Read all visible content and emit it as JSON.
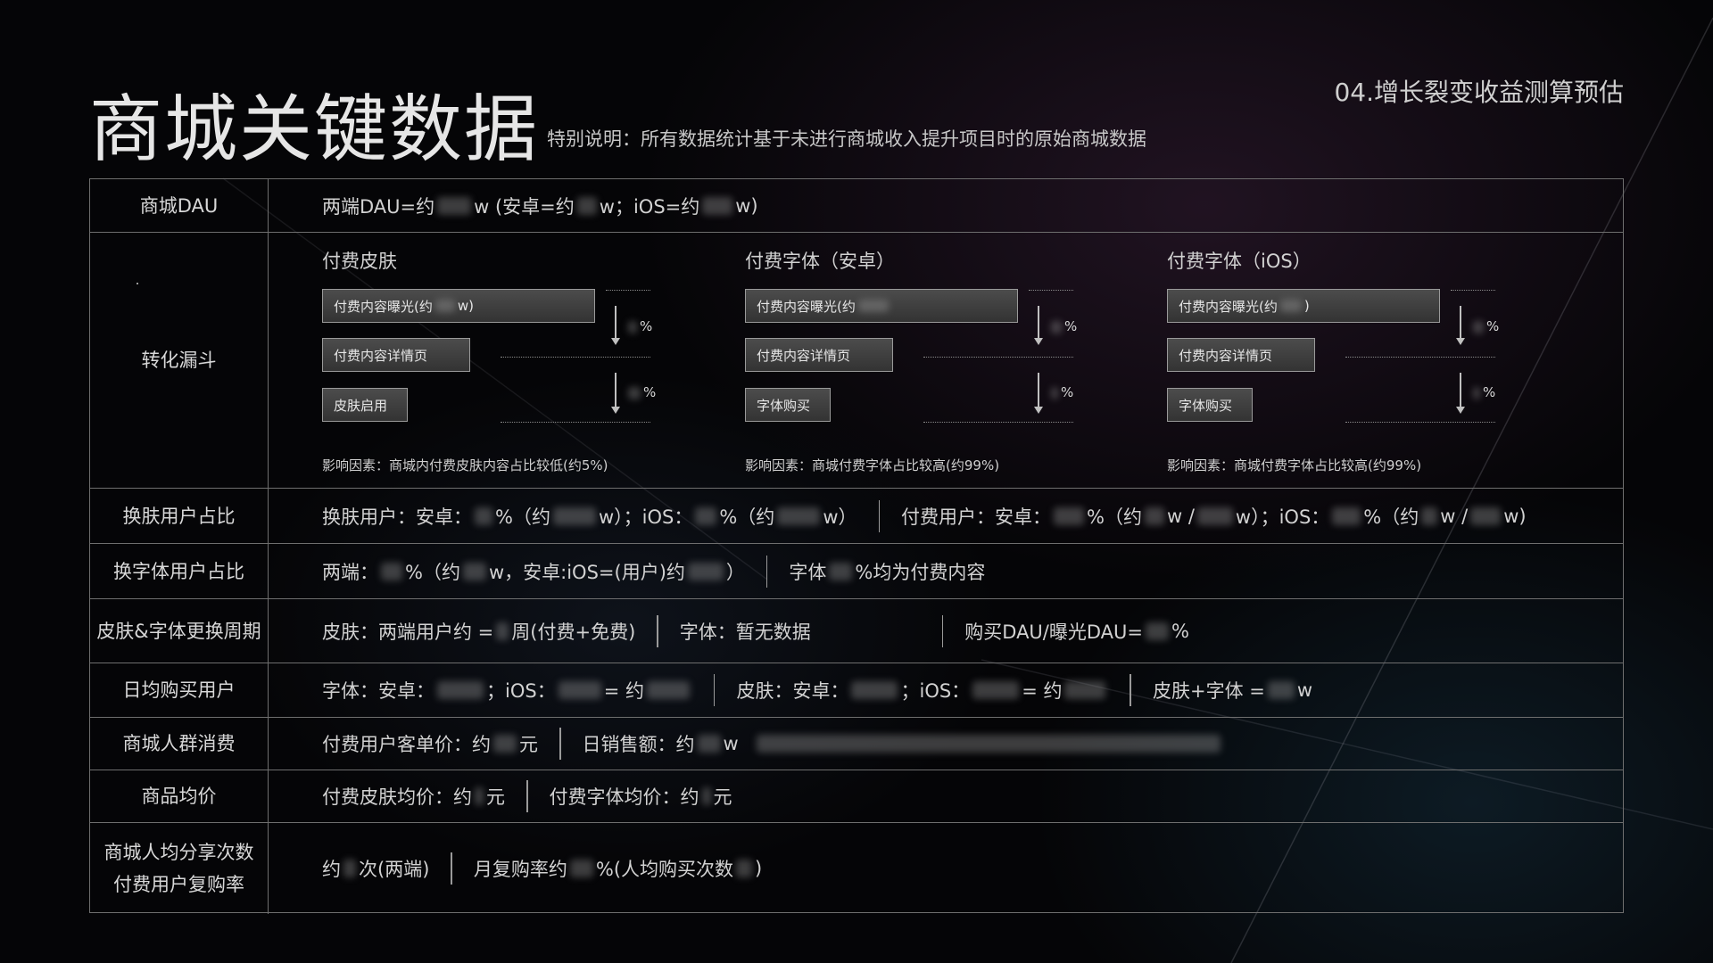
{
  "header": {
    "title": "商城关键数据",
    "subtitle": "特别说明：所有数据统计基于未进行商城收入提升项目时的原始商城数据",
    "section": "04.增长裂变收益测算预估"
  },
  "rows": {
    "dau": {
      "label": "商城DAU",
      "t1": "两端DAU=约",
      "t2": "w (安卓=约",
      "t3": "w；iOS=约",
      "t4": "w)"
    },
    "funnel": {
      "label": "转化漏斗",
      "groups": [
        {
          "heading": "付费皮肤",
          "step1": "付费内容曝光(约",
          "step1_suffix": "w)",
          "step2": "付费内容详情页",
          "step3": "皮肤启用",
          "pct1": "%",
          "pct2": "%",
          "note": "影响因素：商城内付费皮肤内容占比较低(约5%)"
        },
        {
          "heading": "付费字体（安卓）",
          "step1": "付费内容曝光(约",
          "step1_suffix": "",
          "step2": "付费内容详情页",
          "step3": "字体购买",
          "pct1": "%",
          "pct2": "%",
          "note": "影响因素：商城付费字体占比较高(约99%)"
        },
        {
          "heading": "付费字体（iOS）",
          "step1": "付费内容曝光(约",
          "step1_suffix": ")",
          "step2": "付费内容详情页",
          "step3": "字体购买",
          "pct1": "%",
          "pct2": "%",
          "note": "影响因素：商城付费字体占比较高(约99%)"
        }
      ]
    },
    "skin_ratio": {
      "label": "换肤用户占比",
      "a1": "换肤用户：安卓：",
      "a2": "%（约",
      "a3": "w）；iOS：",
      "a4": "%（约",
      "a5": "w）",
      "b1": "付费用户：安卓：",
      "b2": "%（约",
      "b3": "w /",
      "b4": "w）；iOS：",
      "b5": "%（约",
      "b6": "w /",
      "b7": "w)"
    },
    "font_ratio": {
      "label": "换字体用户占比",
      "a1": "两端：",
      "a2": "%（约",
      "a3": "w，安卓:iOS=(用户)约",
      "a4": "）",
      "b1": "字体",
      "b2": "%均为付费内容"
    },
    "cycle": {
      "label": "皮肤&字体更换周期",
      "a1": "皮肤：两端用户约 =",
      "a2": "周(付费+免费)",
      "b1": "字体：暂无数据",
      "c1": "购买DAU/曝光DAU=",
      "c2": "%"
    },
    "daily_buyers": {
      "label": "日均购买用户",
      "a1": "字体：安卓：",
      "a2": "；iOS：",
      "a3": "= 约",
      "b1": "皮肤：安卓：",
      "b2": "；iOS：",
      "b3": "= 约",
      "c1": "皮肤+字体 =",
      "c2": "w"
    },
    "consumption": {
      "label": "商城人群消费",
      "a1": "付费用户客单价：约",
      "a2": "元",
      "b1": "日销售额：约",
      "b2": "w"
    },
    "avg_price": {
      "label": "商品均价",
      "a1": "付费皮肤均价：约",
      "a2": "元",
      "b1": "付费字体均价：约",
      "b2": "元"
    },
    "share": {
      "label_line1": "商城人均分享次数",
      "label_line2": "付费用户复购率",
      "a1": "约",
      "a2": "次(两端)",
      "b1": "月复购率约",
      "b2": "%(人均购买次数",
      "b3": ")"
    }
  }
}
